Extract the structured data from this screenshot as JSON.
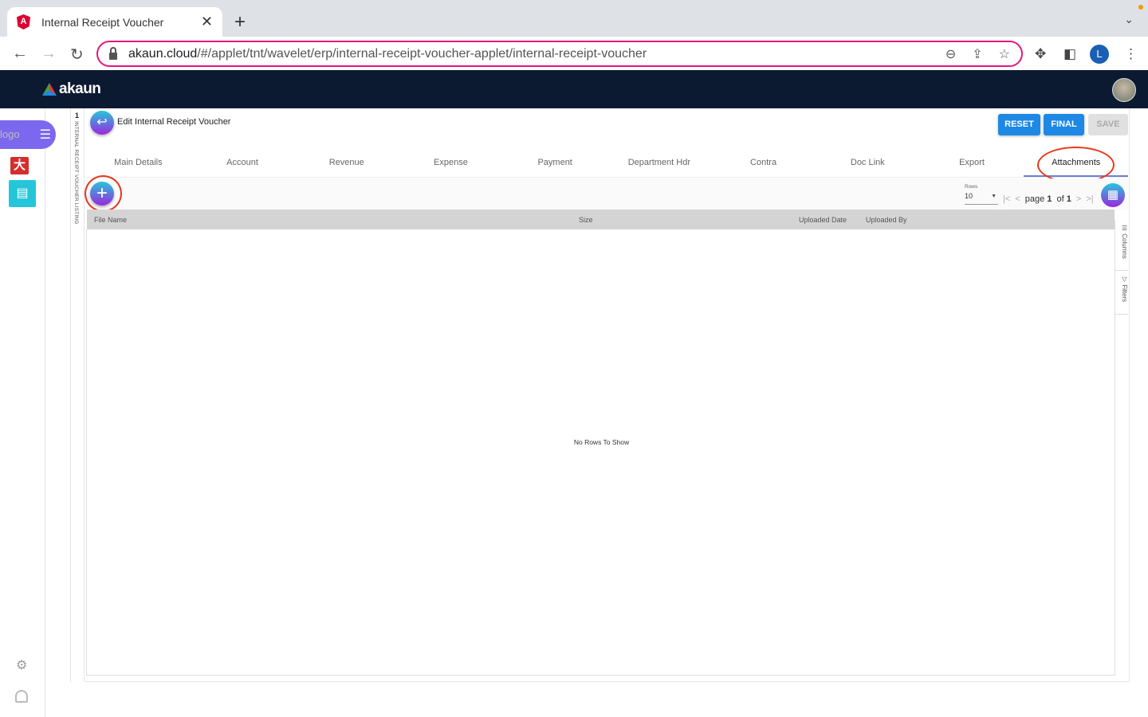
{
  "browser": {
    "tab_title": "Internal Receipt Voucher",
    "url_host": "akaun.cloud",
    "url_path": "/#/applet/tnt/wavelet/erp/internal-receipt-voucher-applet/internal-receipt-voucher",
    "profile_initial": "L"
  },
  "app": {
    "brand": "akaun",
    "sidebar_logo_alt": "logo"
  },
  "strip": {
    "number": "1",
    "label": "INTERNAL RECEIPT VOUCHER LISTING"
  },
  "page": {
    "title": "Edit Internal Receipt Voucher",
    "buttons": {
      "reset": "RESET",
      "final": "FINAL",
      "save": "SAVE"
    },
    "tabs": [
      {
        "label": "Main Details"
      },
      {
        "label": "Account"
      },
      {
        "label": "Revenue"
      },
      {
        "label": "Expense"
      },
      {
        "label": "Payment"
      },
      {
        "label": "Department Hdr"
      },
      {
        "label": "Contra"
      },
      {
        "label": "Doc Link"
      },
      {
        "label": "Export"
      },
      {
        "label": "Attachments",
        "active": true
      }
    ]
  },
  "grid": {
    "rows_label": "Rows",
    "rows_value": "10",
    "page_label": "page",
    "page": "1",
    "of_label": "of",
    "total_pages": "1",
    "columns": [
      "File Name",
      "Size",
      "Uploaded Date",
      "Uploaded By"
    ],
    "empty_text": "No Rows To Show",
    "side_panel": {
      "columns": "Columns",
      "filters": "Filters"
    }
  },
  "colors": {
    "accent": "#1e88e5",
    "header": "#0b1a30",
    "highlight": "#e8371c"
  }
}
